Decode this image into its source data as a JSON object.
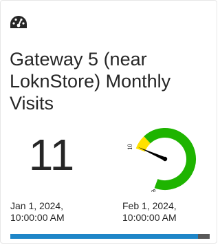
{
  "card": {
    "icon": "dashboard-gauge-icon",
    "title": "Gateway 5 (near LoknStore) Monthly Visits",
    "value": "11",
    "date_start": "Jan 1, 2024, 10:00:00 AM",
    "date_end": "Feb 1, 2024, 10:00:00 AM",
    "progress_fraction": 0.94
  },
  "gauge": {
    "min_label": "10",
    "max_label": "80",
    "min": 10,
    "max": 80,
    "value": 11,
    "yellow_band": [
      10,
      17
    ],
    "green_band": [
      17,
      80
    ],
    "colors": {
      "yellow": "#ffe100",
      "green": "#1eb400",
      "needle": "#000000"
    }
  },
  "colors": {
    "progress_fill": "#1f86c8",
    "progress_track": "#595959",
    "text": "#262626"
  }
}
